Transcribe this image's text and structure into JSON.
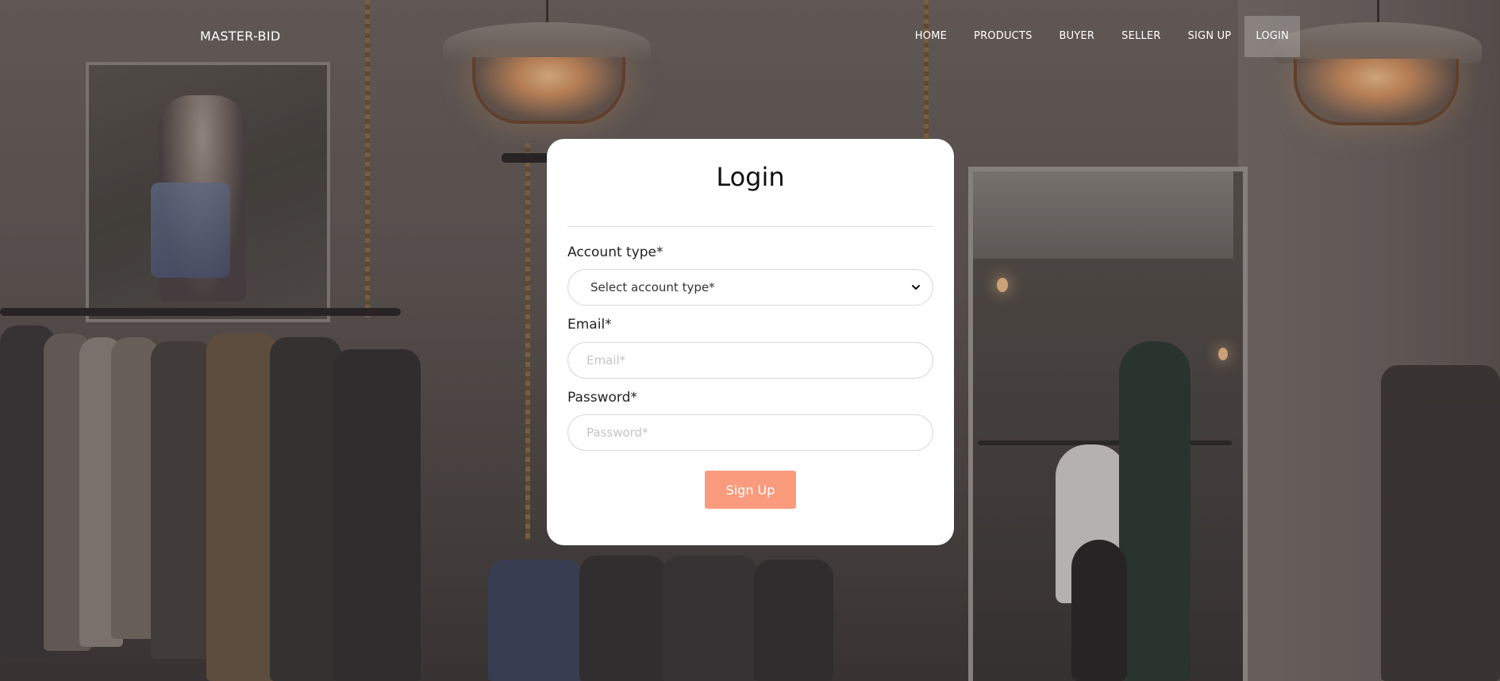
{
  "nav": {
    "brand": "MASTER-BID",
    "items": [
      {
        "label": "HOME"
      },
      {
        "label": "PRODUCTS"
      },
      {
        "label": "BUYER"
      },
      {
        "label": "SELLER"
      },
      {
        "label": "SIGN UP"
      },
      {
        "label": "LOGIN",
        "active": true
      }
    ]
  },
  "form": {
    "title": "Login",
    "account_type": {
      "label": "Account type*",
      "selected": "Select account type*",
      "icon": "chevron-down-icon"
    },
    "email": {
      "label": "Email*",
      "value": "",
      "placeholder": "Email*"
    },
    "password": {
      "label": "Password*",
      "value": "",
      "placeholder": "Password*"
    },
    "submit_label": "Sign Up"
  },
  "colors": {
    "accent": "#fa9b7d",
    "card": "#ffffff",
    "nav_text": "#ffffff"
  }
}
